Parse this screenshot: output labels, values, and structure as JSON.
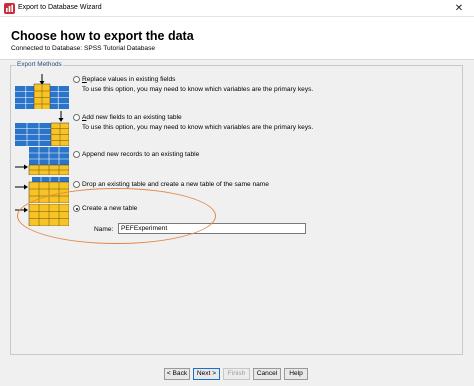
{
  "window": {
    "title": "Export to Database Wizard",
    "close_glyph": "✕"
  },
  "header": {
    "title": "Choose how to export the data",
    "connection": "Connected to Database: SPSS Tutorial Database"
  },
  "export_methods": {
    "group_label": "Export Methods",
    "options": [
      {
        "mnemonic": "R",
        "label": "eplace values in existing fields",
        "description": "To use this option, you may need to know which variables are the primary keys.",
        "selected": false,
        "icon": "replace-values-icon"
      },
      {
        "mnemonic": "A",
        "label": "dd new fields to an existing table",
        "description": "To use this option, you may need to know which variables are the primary keys.",
        "selected": false,
        "icon": "add-fields-icon"
      },
      {
        "mnemonic": "",
        "label": "Append new records to an existing table",
        "description": "",
        "selected": false,
        "icon": "append-records-icon"
      },
      {
        "mnemonic": "",
        "label": "Drop an existing table and create a new table of the same name",
        "description": "",
        "selected": false,
        "icon": "drop-table-icon"
      },
      {
        "mnemonic": "",
        "label": "Create a new table",
        "description": "",
        "selected": true,
        "icon": "create-table-icon"
      }
    ],
    "name_label": "Name:",
    "name_value": "PEFExperiment"
  },
  "buttons": {
    "back": "< Back",
    "next": "Next >",
    "finish": "Finish",
    "cancel": "Cancel",
    "help": "Help"
  },
  "colors": {
    "table_yellow": "#f7c325",
    "table_blue": "#2a75c9",
    "annotation_orange": "#e3884a"
  }
}
